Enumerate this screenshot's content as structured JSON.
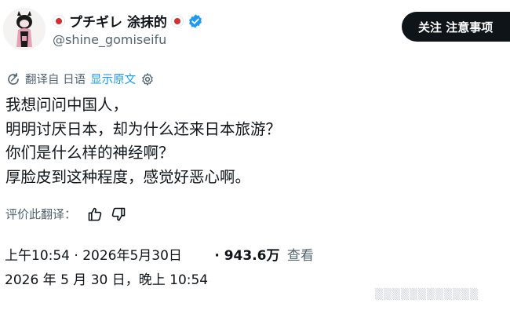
{
  "header": {
    "display_name": "プチギレ 涂抹的",
    "handle": "@shine_gomiseifu",
    "follow_label": "关注 注意事项"
  },
  "translation": {
    "translated_from": "翻译自 日语",
    "show_original": "显示原文"
  },
  "tweet": {
    "lines": [
      "我想问问中国人，",
      "明明讨厌日本，却为什么还来日本旅游？",
      "你们是什么样的神经啊？",
      "厚脸皮到这种程度，感觉好恶心啊。"
    ]
  },
  "rate": {
    "label": "评价此翻译："
  },
  "meta": {
    "timestamp": "上午10:54 · 2026年5月30日",
    "views_count": "· 943.6万",
    "views_label": "查看",
    "full_date": "2026 年 5 月 30 日，晚上 10:54"
  },
  "colors": {
    "text": "#0f1419",
    "secondary": "#536471",
    "link": "#1d9bf0",
    "verified": "#1d9bf0",
    "flag_red": "#d32f2f",
    "button_bg": "#0f1419"
  },
  "icons": {
    "verified": "verified-badge-icon",
    "translate": "translate-icon",
    "settings": "gear-icon",
    "like": "thumbs-up-icon",
    "dislike": "thumbs-down-icon"
  }
}
